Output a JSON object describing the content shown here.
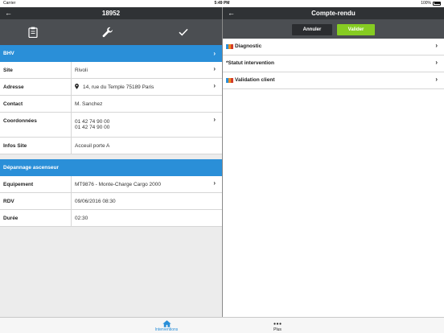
{
  "status_bar": {
    "carrier": "Carrier",
    "time": "5:49 PM",
    "battery": "100%"
  },
  "left_pane": {
    "title": "18952",
    "section1": {
      "title": "BHV",
      "rows": [
        {
          "label": "Site",
          "value": "Rivoli",
          "has_chevron": true
        },
        {
          "label": "Adresse",
          "value": "14, rue du Temple 75189 Paris",
          "has_chevron": true
        },
        {
          "label": "Contact",
          "value": "M. Sanchez",
          "has_chevron": false
        },
        {
          "label": "Coordonnées",
          "value": "01 42 74 90 00",
          "value2": "01 42 74 90 00",
          "has_chevron": true
        },
        {
          "label": "Infos Site",
          "value": "Acceuil porte A",
          "has_chevron": false
        }
      ]
    },
    "section2": {
      "title": "Dépannage ascenseur",
      "rows": [
        {
          "label": "Equipement",
          "value": "MT9876 - Monte-Charge Cargo 2000",
          "has_chevron": true
        },
        {
          "label": "RDV",
          "value": "09/06/2016 08:30",
          "has_chevron": false
        },
        {
          "label": "Durée",
          "value": "02:30",
          "has_chevron": false
        }
      ]
    }
  },
  "right_pane": {
    "title": "Compte-rendu",
    "cancel_label": "Annuler",
    "validate_label": "Valider",
    "items": [
      {
        "label": "Diagnostic",
        "flag": true
      },
      {
        "label": "*Statut intervention",
        "flag": false
      },
      {
        "label": "Validation client",
        "flag": true
      }
    ]
  },
  "tab_bar": {
    "tabs": [
      {
        "label": "Interventions",
        "icon": "home-icon",
        "active": true
      },
      {
        "label": "Plus",
        "icon": "more-icon",
        "active": false
      }
    ]
  },
  "colors": {
    "accent": "#2a8fd8",
    "validate": "#86cc22",
    "navbar": "#2f3235",
    "toolbar": "#4b4e52"
  }
}
